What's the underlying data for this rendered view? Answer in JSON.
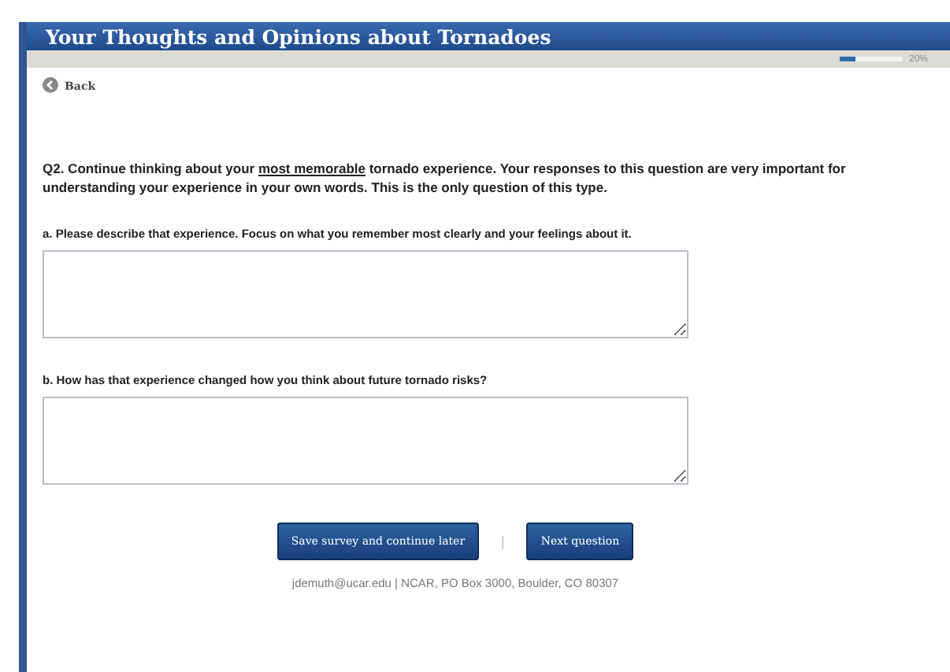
{
  "window": {
    "title": "Your Thoughts and Opinions about Tornadoes"
  },
  "progress": {
    "level": 0.25,
    "reading": "20%"
  },
  "back": "Back",
  "intro": [
    {
      "text": "Q2. Continue thinking about your ",
      "underlined": false
    },
    {
      "text": "most memorable",
      "underlined": true
    },
    {
      "text": " tornado experience. Your responses to this question are very important for understanding your experience in your own words. This is the only question of this type.",
      "underlined": false
    }
  ],
  "questions": [
    {
      "label": "a. Please describe that experience. Focus on what you remember most clearly and your feelings about it."
    },
    {
      "label": "b. How has that experience changed how you think about future tornado risks?"
    }
  ],
  "buttons": [
    {
      "label": "Save survey and continue later"
    },
    {
      "label": "Next question"
    }
  ],
  "separator": "|",
  "footer": "jdemuth@ucar.edu | NCAR, PO Box 3000, Boulder, CO 80307"
}
